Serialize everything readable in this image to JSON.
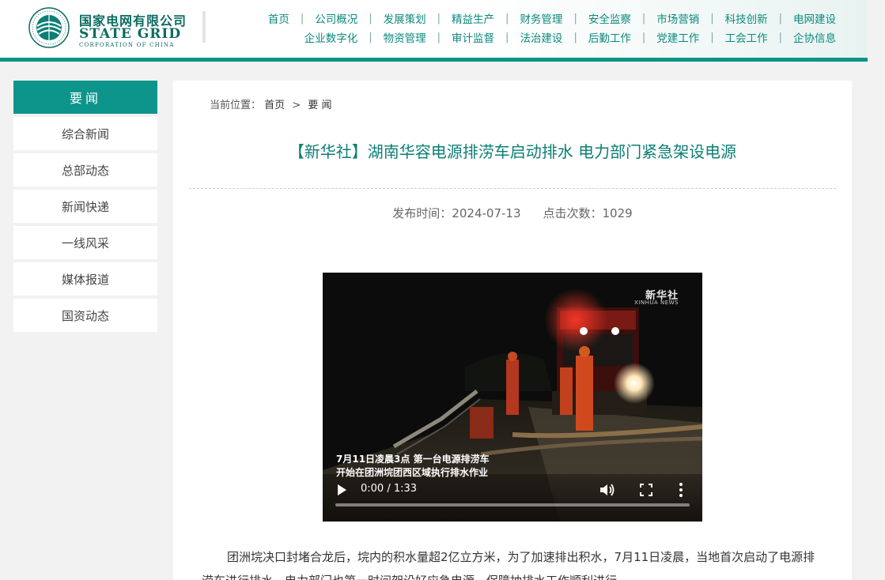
{
  "header": {
    "logo_cn": "国家电网有限公司",
    "logo_en": "STATE GRID",
    "logo_en_sub": "CORPORATION OF CHINA",
    "logo_ring_text": "国家电网 STATE GRID CORPORATION OF CHINA",
    "nav_row1": [
      "首页",
      "公司概况",
      "发展策划",
      "精益生产",
      "财务管理",
      "安全监察",
      "市场营销",
      "科技创新",
      "电网建设"
    ],
    "nav_row2": [
      "企业数字化",
      "物资管理",
      "审计监督",
      "法治建设",
      "后勤工作",
      "党建工作",
      "工会工作",
      "企协信息"
    ],
    "nav_separator": "|",
    "accent_color": "#0d9488"
  },
  "sidebar": {
    "heading": "要闻",
    "items": [
      "综合新闻",
      "总部动态",
      "新闻快递",
      "一线风采",
      "媒体报道",
      "国资动态"
    ]
  },
  "breadcrumb": {
    "label": "当前位置：",
    "home": "首页",
    "separator": ">",
    "current": "要 闻"
  },
  "article": {
    "title": "【新华社】湖南华容电源排涝车启动排水 电力部门紧急架设电源",
    "published_label": "发布时间：",
    "published_value": "2024-07-13",
    "clicks_label": "点击次数：",
    "clicks_value": "1029",
    "paragraph": "团洲垸决口封堵合龙后，垸内的积水量超2亿立方米，为了加速排出积水，7月11日凌晨，当地首次启动了电源排涝车进行排水，电力部门也第一时间架设好应急电源，保障抽排水工作顺利进行。"
  },
  "video": {
    "watermark_cn": "新华社",
    "watermark_en": "XINHUA NEWS",
    "caption_line1": "7月11日凌晨3点  第一台电源排涝车",
    "caption_line2": "开始在团洲垸团西区域执行排水作业",
    "time_display": "0:00 / 1:33",
    "progress_fraction": 0,
    "icons": [
      "play-icon",
      "volume-icon",
      "fullscreen-icon",
      "more-vert-icon"
    ]
  }
}
